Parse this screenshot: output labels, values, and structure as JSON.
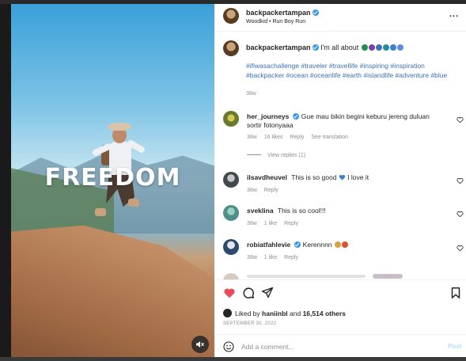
{
  "media": {
    "overlay_text": "FREEDOM",
    "mute_icon": "speaker-muted-icon"
  },
  "header": {
    "username": "backpackertampan",
    "music": "Woodkid • Run Boy Run",
    "more_label": "..."
  },
  "caption": {
    "username": "backpackertampan",
    "text": "I'm all about",
    "hashtags": "#ifiwasachallenge #traveler #travellife #inspiring #inspiration #backpacker #ocean #oceanlife #earth #islandlife #adventure #blue",
    "age": "38w",
    "emoji_colors": [
      "#1f8f4e",
      "#7b3fa0",
      "#3f6fb4",
      "#1f8f9e",
      "#3a82d0",
      "#5a8ce0"
    ]
  },
  "comments": [
    {
      "username": "her_journeys",
      "verified": true,
      "text": "Gue mau bikin begini keburu jereng duluan sortir fotonyaaa",
      "age": "38w",
      "likes": "16 likes",
      "reply": "Reply",
      "extra": "See translation",
      "avatar_color": "#6b7a2a"
    },
    {
      "username": "ilsavdheuvel",
      "verified": false,
      "text": "This is so good",
      "text_after": "I love it",
      "age": "38w",
      "likes": "",
      "reply": "Reply",
      "avatar_color": "#404a4e"
    },
    {
      "username": "sveklina",
      "verified": false,
      "text": "This is so cool!!!",
      "age": "38w",
      "likes": "1 like",
      "reply": "Reply",
      "avatar_color": "#4f8f8a"
    },
    {
      "username": "robiatfahlevie",
      "verified": true,
      "text": "Kerennnn",
      "age": "38w",
      "likes": "1 like",
      "reply": "Reply",
      "avatar_color": "#2d4a6e"
    }
  ],
  "view_replies": "View replies (1)",
  "likes": {
    "prefix": "Liked by",
    "user": "haniinbl",
    "joiner": "and",
    "others": "16,514 others"
  },
  "date": "SEPTEMBER 30, 2022",
  "comment_box": {
    "placeholder": "Add a comment...",
    "post_label": "Post"
  },
  "colors": {
    "like_red": "#ed4956",
    "link_blue": "#3f6fb4",
    "verified_blue": "#3897f0",
    "muted_gray": "#8e8e8e"
  }
}
